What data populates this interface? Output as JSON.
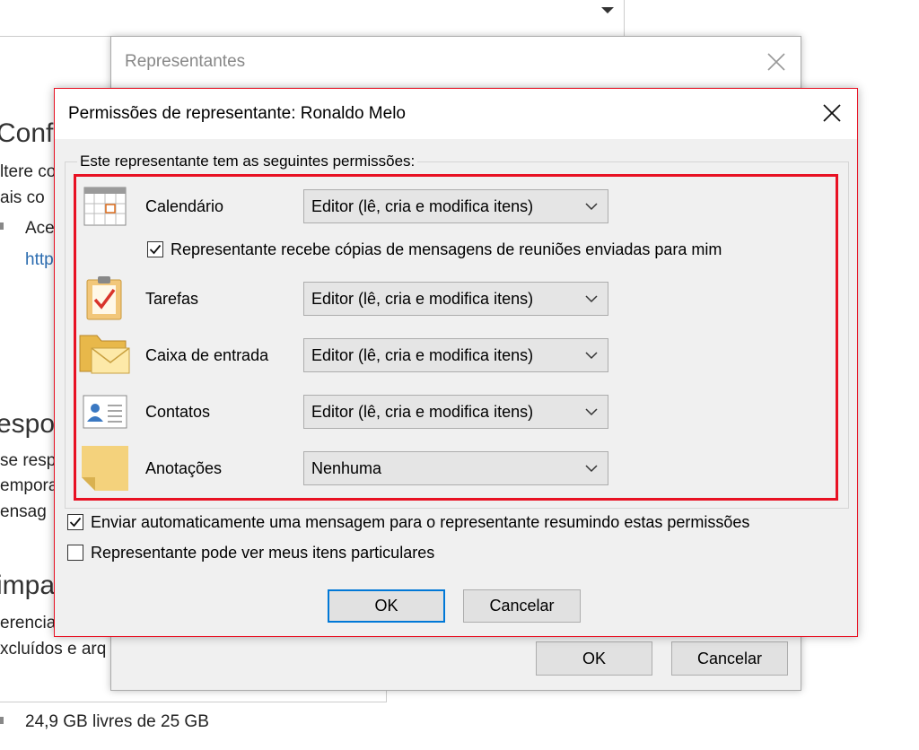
{
  "background": {
    "partial_texts": [
      "Confi",
      "ltere co",
      "ais co",
      "Ace",
      "http",
      "espo",
      "se resp",
      "empora",
      "ensag",
      "impa",
      "erencia",
      "xcluídos e arq"
    ],
    "storage": "24,9 GB livres de 25 GB"
  },
  "rep_dialog": {
    "title": "Representantes",
    "ok": "OK",
    "cancel": "Cancelar"
  },
  "perm_dialog": {
    "title": "Permissões de representante: Ronaldo Melo",
    "group_label": "Este representante tem as seguintes permissões:",
    "rows": [
      {
        "label": "Calendário",
        "value": "Editor (lê, cria e modifica itens)",
        "icon": "calendar-icon"
      },
      {
        "label": "Tarefas",
        "value": "Editor (lê, cria e modifica itens)",
        "icon": "tasks-icon"
      },
      {
        "label": "Caixa de entrada",
        "value": "Editor (lê, cria e modifica itens)",
        "icon": "inbox-icon"
      },
      {
        "label": "Contatos",
        "value": "Editor (lê, cria e modifica itens)",
        "icon": "contacts-icon"
      },
      {
        "label": "Anotações",
        "value": "Nenhuma",
        "icon": "notes-icon"
      }
    ],
    "meeting_copies": {
      "label": "Representante recebe cópias de mensagens de reuniões enviadas para mim",
      "checked": true
    },
    "auto_send": {
      "label": "Enviar automaticamente uma mensagem para o representante resumindo estas permissões",
      "checked": true
    },
    "private_items": {
      "label": "Representante pode ver meus itens particulares",
      "checked": false
    },
    "ok": "OK",
    "cancel": "Cancelar"
  },
  "colors": {
    "highlight": "#e81123",
    "accent": "#0078d7"
  }
}
